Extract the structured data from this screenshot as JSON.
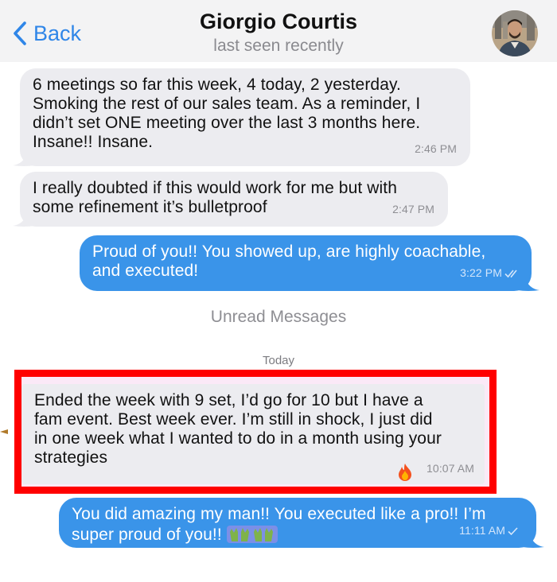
{
  "header": {
    "back_label": "Back",
    "contact_name": "Giorgio Courtis",
    "status": "last seen recently",
    "avatar_icon": "profile-photo",
    "accent_color": "#2f86e8"
  },
  "messages": [
    {
      "direction": "incoming",
      "lines": [
        "6 meetings so far this week, 4 today, 2 yesterday.",
        "Smoking the rest of our sales team.  As a reminder, I",
        "didn’t set ONE meeting over the last 3 months here.",
        "Insane!! Insane."
      ],
      "time": "2:46 PM"
    },
    {
      "direction": "incoming",
      "lines": [
        "I really doubted if this would work for me but with",
        "some refinement it’s bulletproof"
      ],
      "time": "2:47 PM"
    },
    {
      "direction": "outgoing",
      "lines": [
        "Proud of you!! You showed up, are highly coachable,",
        "and executed!"
      ],
      "time": "3:22 PM",
      "receipt": "double-check-icon"
    },
    {
      "direction": "incoming",
      "highlighted": true,
      "lines": [
        "Ended the week with 9 set, I’d go for 10 but I have a",
        "fam event.  Best week ever. I’m still in shock, I just did",
        "in one week what I wanted to do in a month using your",
        "strategies"
      ],
      "reaction": "fire-emoji",
      "time": "10:07 AM"
    },
    {
      "direction": "outgoing",
      "lines": [
        "You did amazing my man!! You executed like a pro!! I’m",
        "super proud of you!!"
      ],
      "emoji": "raising-hands-emoji",
      "time": "11:11 AM",
      "receipt": "single-check-icon"
    }
  ],
  "dividers": {
    "unread": "Unread Messages",
    "date": "Today"
  },
  "colors": {
    "incoming_bubble": "#ececf0",
    "outgoing_bubble": "#3a94e9",
    "highlight_border": "#ff0000"
  }
}
